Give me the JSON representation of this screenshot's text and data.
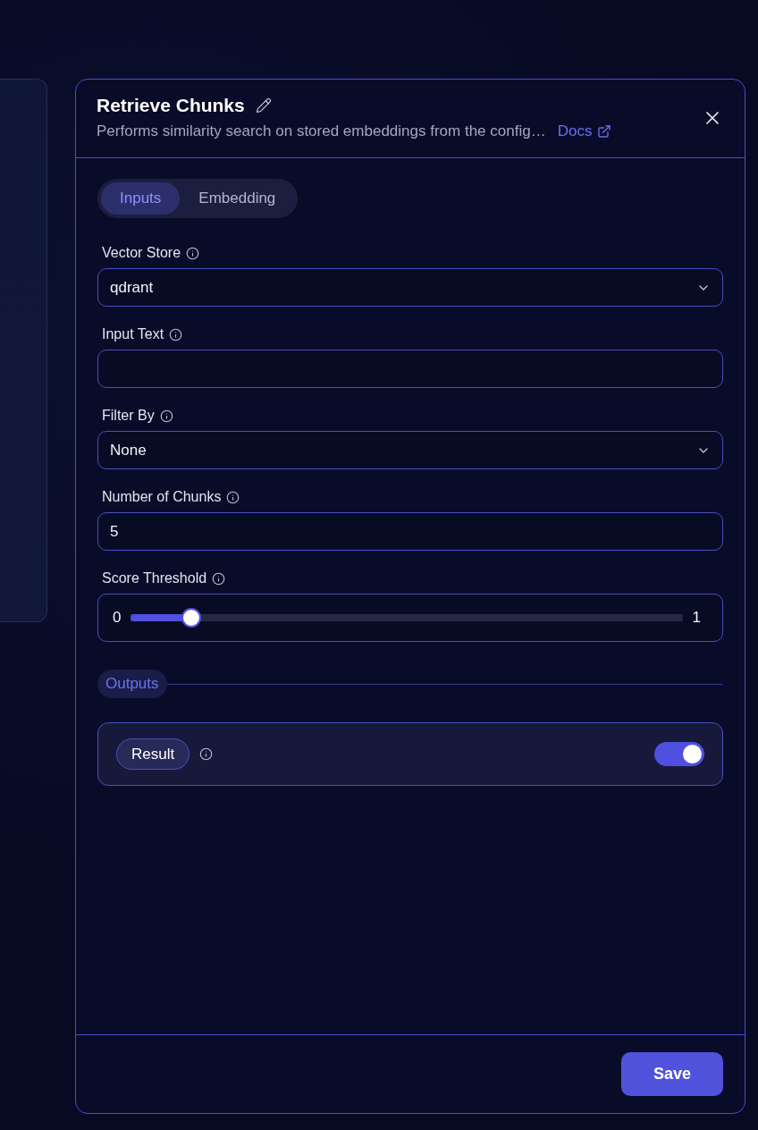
{
  "panel": {
    "title": "Retrieve Chunks",
    "description": "Performs similarity search on stored embeddings from the config…",
    "docs_link": "Docs"
  },
  "tabs": [
    {
      "label": "Inputs",
      "selected": true
    },
    {
      "label": "Embedding",
      "selected": false
    }
  ],
  "fields": [
    {
      "kind": "select",
      "label": "Vector Store",
      "value": "qdrant"
    },
    {
      "kind": "text",
      "label": "Input Text"
    },
    {
      "kind": "select",
      "label": "Filter By",
      "value": "None"
    },
    {
      "kind": "text",
      "label": "Number of Chunks",
      "value": "5"
    },
    {
      "kind": "slider",
      "label": "Score Threshold",
      "min_label": "0",
      "max_label": "1",
      "level": 0.11
    }
  ],
  "outputs": {
    "heading": "Outputs",
    "items": [
      {
        "label": "Result",
        "on": true
      }
    ]
  },
  "footer": {
    "save_button": "Save"
  }
}
